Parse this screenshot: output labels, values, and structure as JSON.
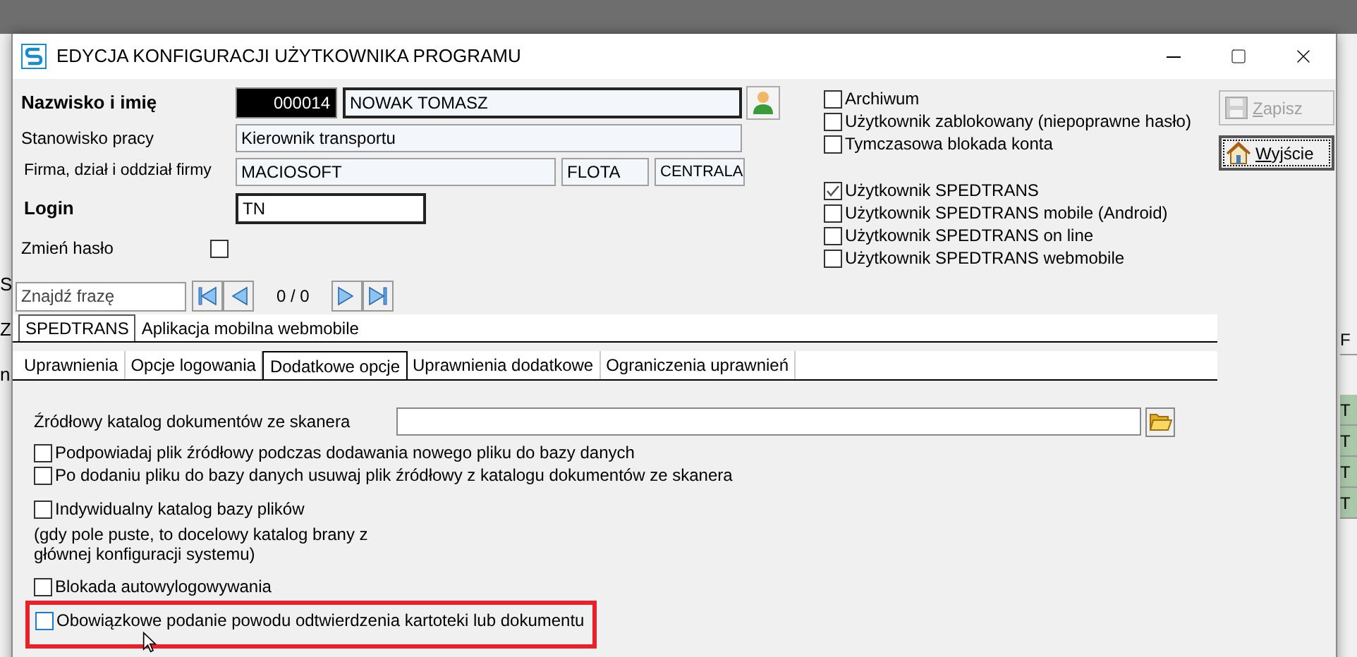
{
  "window": {
    "title": "EDYCJA KONFIGURACJI UŻYTKOWNIKA PROGRAMU"
  },
  "background": {
    "left_fragments": [
      "S",
      "Z",
      "n"
    ],
    "right_fragments": [
      {
        "text": "F",
        "kind": "header"
      },
      {
        "text": "T",
        "kind": "cell"
      },
      {
        "text": "T",
        "kind": "cell"
      },
      {
        "text": "T",
        "kind": "cell"
      },
      {
        "text": "T",
        "kind": "cell"
      }
    ]
  },
  "form": {
    "name_label": "Nazwisko i imię",
    "id": "000014",
    "name": "NOWAK TOMASZ",
    "position_label": "Stanowisko pracy",
    "position": "Kierownik transportu",
    "company_label": "Firma, dział i oddział firmy",
    "company": "MACIOSOFT",
    "department": "FLOTA",
    "branch": "CENTRALA",
    "login_label": "Login",
    "login": "TN",
    "change_password_label": "Zmień hasło",
    "change_password_checked": false
  },
  "account_flags": [
    {
      "label": "Archiwum",
      "checked": false
    },
    {
      "label": "Użytkownik zablokowany (niepoprawne hasło)",
      "checked": false
    },
    {
      "label": "Tymczasowa blokada konta",
      "checked": false
    }
  ],
  "app_flags": [
    {
      "label": "Użytkownik SPEDTRANS",
      "checked": true
    },
    {
      "label": "Użytkownik SPEDTRANS mobile (Android)",
      "checked": false
    },
    {
      "label": "Użytkownik SPEDTRANS on line",
      "checked": false
    },
    {
      "label": "Użytkownik SPEDTRANS webmobile",
      "checked": false
    }
  ],
  "buttons": [
    {
      "label": "Zapisz",
      "kind": "save",
      "disabled": true
    },
    {
      "label": "Wyjście",
      "kind": "exit",
      "disabled": false
    }
  ],
  "search": {
    "placeholder": "Znajdź frazę",
    "counter": "0 / 0"
  },
  "tabs": [
    {
      "label": "SPEDTRANS",
      "selected": true
    },
    {
      "label": "Aplikacja mobilna webmobile",
      "selected": false
    }
  ],
  "subtabs": [
    {
      "label": "Uprawnienia",
      "selected": false
    },
    {
      "label": "Opcje logowania",
      "selected": false
    },
    {
      "label": "Dodatkowe opcje",
      "selected": true
    },
    {
      "label": "Uprawnienia dodatkowe",
      "selected": false
    },
    {
      "label": "Ograniczenia uprawnień",
      "selected": false
    }
  ],
  "scanner_folder": {
    "label": "Źródłowy katalog dokumentów ze skanera"
  },
  "option_groups": [
    [
      {
        "kind": "checkbox",
        "label": "Podpowiadaj plik źródłowy podczas dodawania nowego pliku do bazy danych",
        "checked": false,
        "highlighted": false
      },
      {
        "kind": "checkbox",
        "label": "Po dodaniu pliku do bazy danych usuwaj plik źródłowy z katalogu dokumentów ze skanera",
        "checked": false,
        "highlighted": false
      }
    ],
    [
      {
        "kind": "checkbox",
        "label": "Indywidualny katalog bazy plików",
        "checked": false,
        "highlighted": false
      },
      {
        "kind": "note",
        "label": "(gdy pole puste, to docelowy katalog brany z głównej konfiguracji systemu)"
      }
    ],
    [
      {
        "kind": "checkbox",
        "label": "Blokada autowylogowywania",
        "checked": false,
        "highlighted": false
      },
      {
        "kind": "checkbox",
        "label": "Obowiązkowe podanie powodu odtwierdzenia kartoteki lub dokumentu",
        "checked": false,
        "highlighted": true
      }
    ]
  ]
}
